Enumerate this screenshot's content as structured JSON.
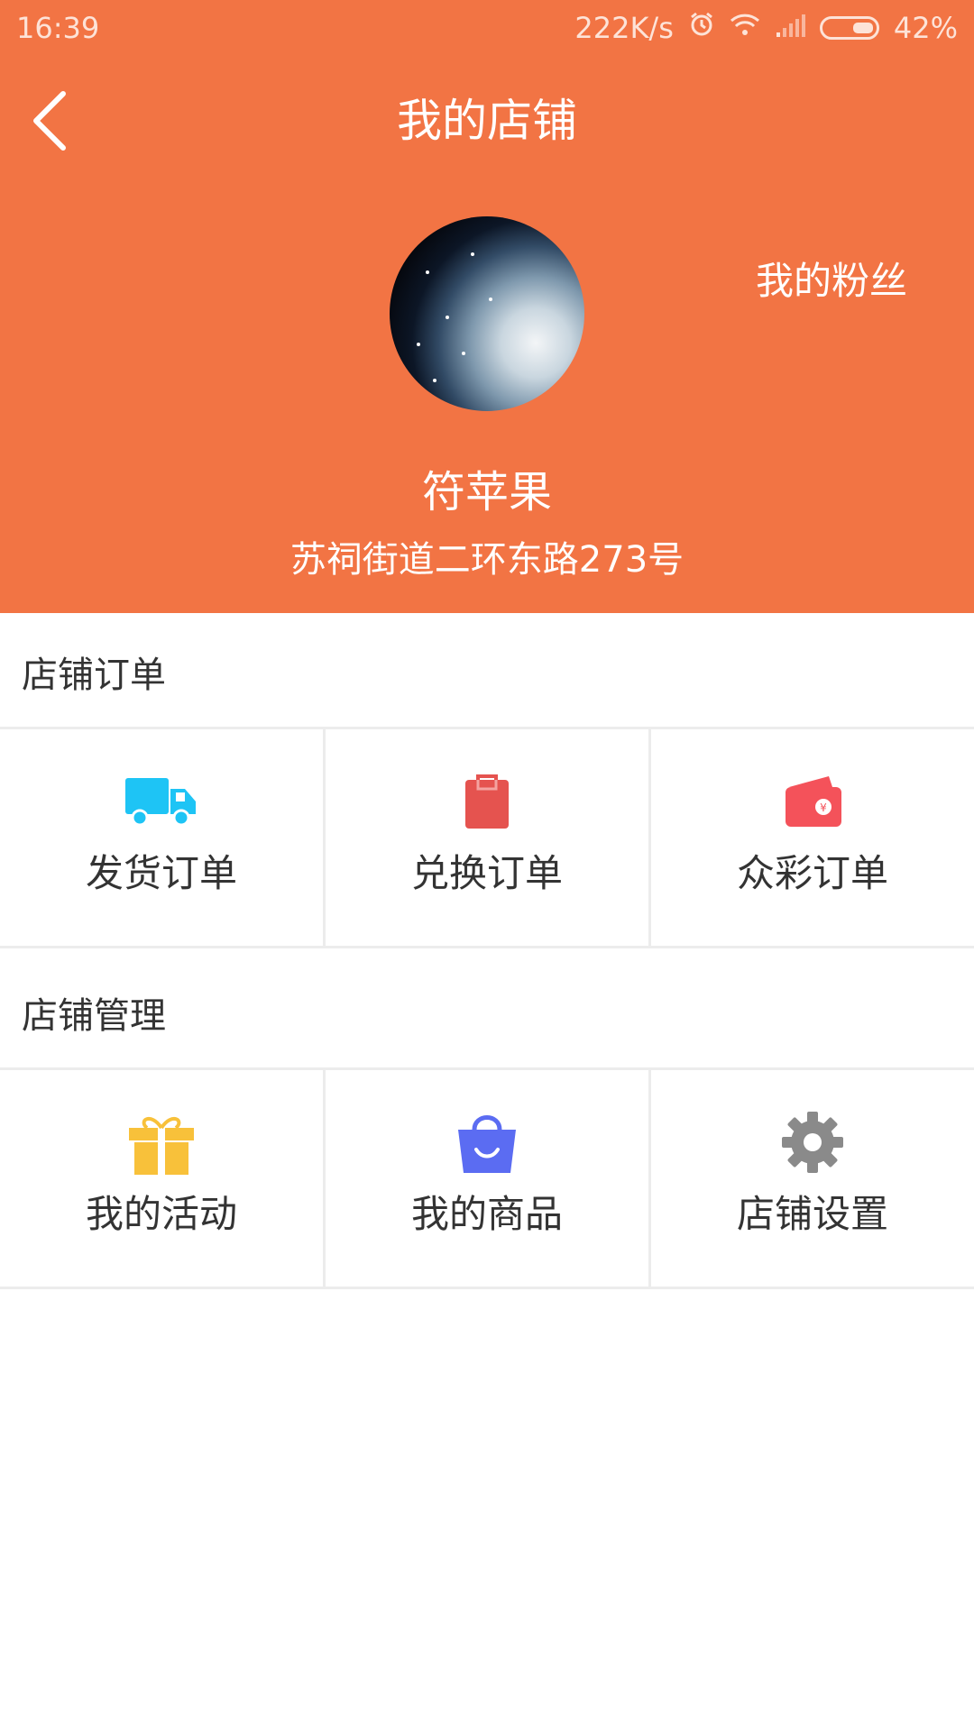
{
  "status_bar": {
    "time": "16:39",
    "speed": "222K/s",
    "battery": "42%"
  },
  "nav": {
    "title": "我的店铺"
  },
  "profile": {
    "fans_label": "我的粉丝",
    "name": "符苹果",
    "address": "苏祠街道二环东路273号"
  },
  "sections": {
    "orders": {
      "title": "店铺订单",
      "items": [
        {
          "label": "发货订单",
          "icon": "truck-icon",
          "color": "#1ec4f5"
        },
        {
          "label": "兑换订单",
          "icon": "clipboard-icon",
          "color": "#e5534f"
        },
        {
          "label": "众彩订单",
          "icon": "wallet-icon",
          "color": "#f4525a"
        }
      ]
    },
    "manage": {
      "title": "店铺管理",
      "items": [
        {
          "label": "我的活动",
          "icon": "gift-icon",
          "color": "#f8c13a"
        },
        {
          "label": "我的商品",
          "icon": "shopping-bag-icon",
          "color": "#5b6cf2"
        },
        {
          "label": "店铺设置",
          "icon": "gear-icon",
          "color": "#8a8a8a"
        }
      ]
    }
  },
  "colors": {
    "header": "#f27444"
  }
}
